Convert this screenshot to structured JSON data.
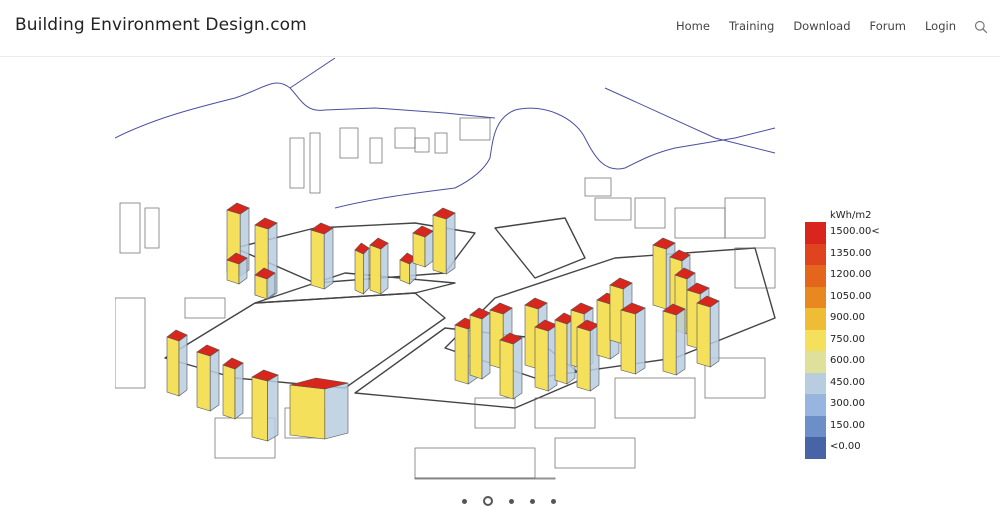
{
  "header": {
    "site_title": "Building Environment Design.com",
    "nav": [
      {
        "label": "Home"
      },
      {
        "label": "Training"
      },
      {
        "label": "Download"
      },
      {
        "label": "Forum"
      },
      {
        "label": "Login"
      }
    ],
    "search_icon": "search-icon"
  },
  "slider": {
    "image_description": "Isometric urban massing model with buildings colored by solar radiation",
    "legend": {
      "unit": "kWh/m2",
      "bins": [
        {
          "label": "1500.00<",
          "color": "#d9261c"
        },
        {
          "label": "1350.00",
          "color": "#e0441e"
        },
        {
          "label": "1200.00",
          "color": "#e4651c"
        },
        {
          "label": "1050.00",
          "color": "#e8891f"
        },
        {
          "label": "900.00",
          "color": "#efbd35"
        },
        {
          "label": "750.00",
          "color": "#f4e05a"
        },
        {
          "label": "600.00",
          "color": "#dfe09a"
        },
        {
          "label": "450.00",
          "color": "#b9cde0"
        },
        {
          "label": "300.00",
          "color": "#98b5e0"
        },
        {
          "label": "150.00",
          "color": "#6d8fc9"
        },
        {
          "label": "<0.00",
          "color": "#4863a6"
        }
      ]
    },
    "pagination": {
      "count": 5,
      "active_index": 1
    }
  },
  "colors": {
    "roof": "#d9261c",
    "wall": "#f4e05a",
    "wall_shade": "#b9cde0",
    "contour": "#4a4fa0",
    "outline": "#555555"
  }
}
